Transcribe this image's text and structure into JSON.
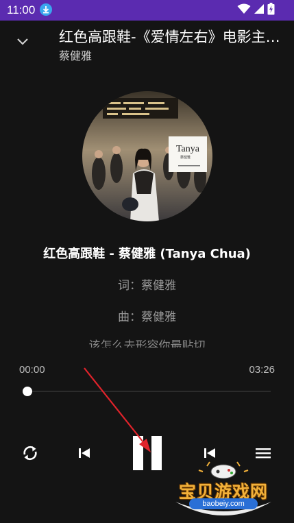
{
  "status_bar": {
    "time": "11:00",
    "download_icon": "download-icon",
    "wifi_icon": "wifi-icon",
    "signal_icon": "signal-icon",
    "battery_icon": "battery-charging-icon",
    "background_color": "#5b2bb0"
  },
  "header": {
    "collapse_icon": "chevron-down-icon",
    "title": "红色高跟鞋-《爱情左右》电影主题曲",
    "artist": "蔡健雅"
  },
  "album_art": {
    "cover_text": "Tanya",
    "cover_subtext": "蔡健雅"
  },
  "lyrics": {
    "current": "红色高跟鞋 - 蔡健雅 (Tanya Chua)",
    "lines": [
      "词：蔡健雅",
      "曲：蔡健雅"
    ],
    "next": "该怎么去形容你最贴切"
  },
  "progress": {
    "current_time": "00:00",
    "total_time": "03:26",
    "fraction": 0
  },
  "controls": {
    "repeat_icon": "repeat-icon",
    "previous_icon": "previous-icon",
    "play_pause_icon": "pause-icon",
    "next_icon": "next-icon",
    "playlist_icon": "playlist-icon"
  },
  "watermark": {
    "title": "宝贝游戏网",
    "url": "baobeiy.com"
  },
  "colors": {
    "background": "#141414",
    "annotation_arrow": "#e0232b",
    "watermark_gold": "#f2b13a"
  }
}
